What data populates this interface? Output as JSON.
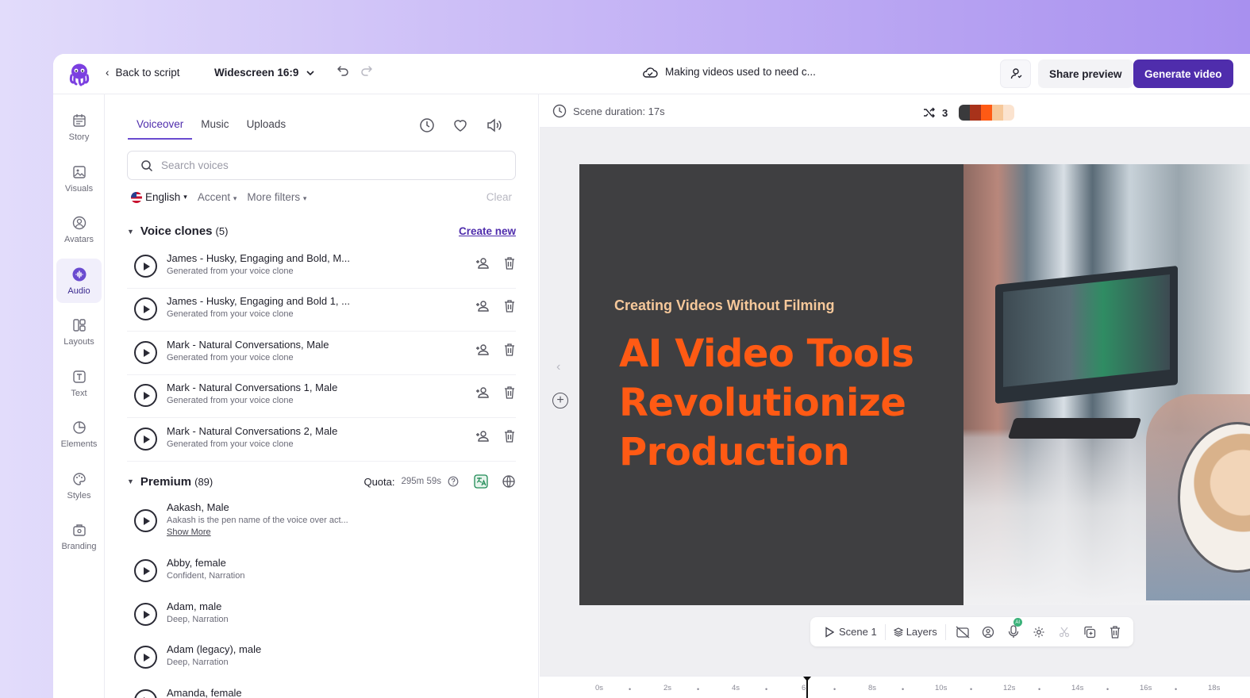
{
  "topbar": {
    "back_label": "Back to script",
    "ratio_label": "Widescreen 16:9",
    "project_title": "Making videos used to need c...",
    "share_label": "Share preview",
    "generate_label": "Generate video"
  },
  "rail": {
    "items": [
      {
        "label": "Story",
        "icon": "calendar-icon"
      },
      {
        "label": "Visuals",
        "icon": "image-icon"
      },
      {
        "label": "Avatars",
        "icon": "avatar-icon"
      },
      {
        "label": "Audio",
        "icon": "audio-wave-icon",
        "active": true
      },
      {
        "label": "Layouts",
        "icon": "layout-icon"
      },
      {
        "label": "Text",
        "icon": "text-icon"
      },
      {
        "label": "Elements",
        "icon": "shapes-icon"
      },
      {
        "label": "Styles",
        "icon": "palette-icon"
      },
      {
        "label": "Branding",
        "icon": "brand-kit-icon"
      }
    ]
  },
  "panel": {
    "tabs": [
      "Voiceover",
      "Music",
      "Uploads"
    ],
    "active_tab": "Voiceover",
    "search_placeholder": "Search voices",
    "filters": {
      "language": "English",
      "accent": "Accent",
      "more": "More filters",
      "clear": "Clear"
    },
    "voice_clones": {
      "title": "Voice clones",
      "count": "(5)",
      "create_label": "Create new",
      "items": [
        {
          "name": "James - Husky, Engaging and Bold, M...",
          "sub": "Generated from your voice clone"
        },
        {
          "name": "James - Husky, Engaging and Bold 1, ...",
          "sub": "Generated from your voice clone"
        },
        {
          "name": "Mark - Natural Conversations, Male",
          "sub": "Generated from your voice clone"
        },
        {
          "name": "Mark - Natural Conversations 1, Male",
          "sub": "Generated from your voice clone"
        },
        {
          "name": "Mark - Natural Conversations 2, Male",
          "sub": "Generated from your voice clone"
        }
      ]
    },
    "premium": {
      "title": "Premium",
      "count": "(89)",
      "quota_label": "Quota:",
      "quota_value": "295m 59s",
      "items": [
        {
          "name": "Aakash, Male",
          "sub": "Aakash is the pen name of the voice over act...",
          "more": "Show More"
        },
        {
          "name": "Abby, female",
          "sub": "Confident, Narration"
        },
        {
          "name": "Adam, male",
          "sub": "Deep, Narration"
        },
        {
          "name": "Adam (legacy), male",
          "sub": "Deep, Narration"
        },
        {
          "name": "Amanda, female",
          "sub": ""
        }
      ]
    }
  },
  "editor": {
    "scene_duration": "Scene duration: 17s",
    "variations": "3",
    "palette": [
      "#3a3a3c",
      "#a8321a",
      "#ff5a14",
      "#f6c89a",
      "#fbe3cf"
    ],
    "slide": {
      "kicker": "Creating Videos Without Filming",
      "title_lines": [
        "AI Video Tools",
        "Revolutionize",
        "Production"
      ]
    },
    "toolbar": {
      "scene_label": "Scene 1",
      "layers_label": "Layers",
      "mic_badge": "AI"
    },
    "timeline": {
      "ticks": [
        "0s",
        "2s",
        "4s",
        "6",
        "8s",
        "10s",
        "12s",
        "14s",
        "16s",
        "18s"
      ]
    }
  }
}
